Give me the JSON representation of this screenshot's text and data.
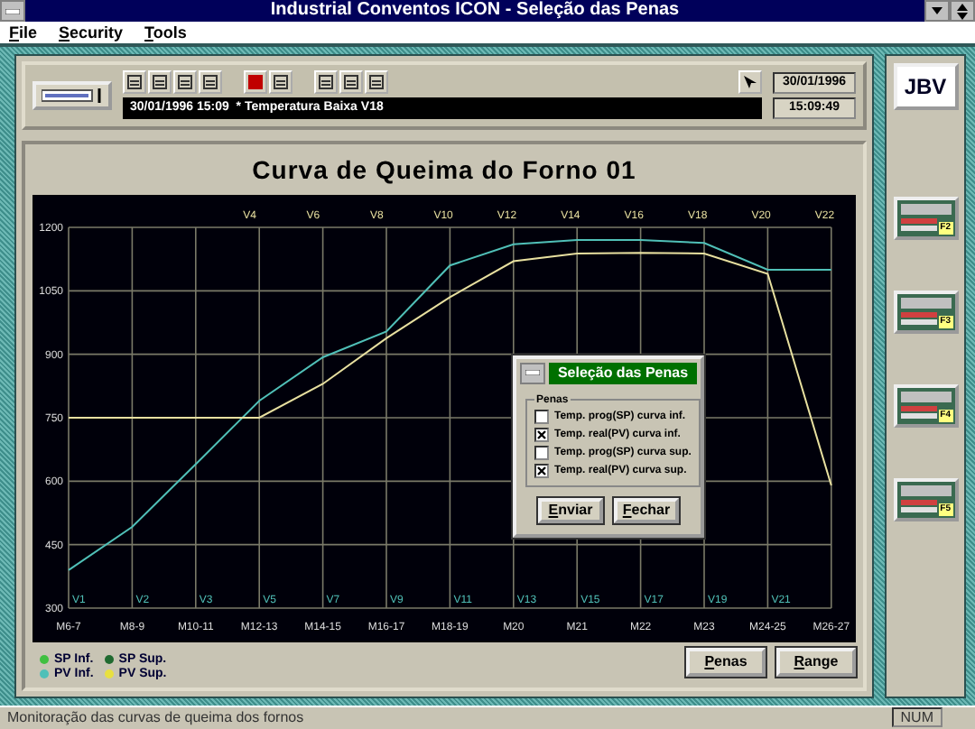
{
  "window": {
    "title": "Industrial Conventos ICON - Seleção das Penas"
  },
  "menu": [
    {
      "label": "File"
    },
    {
      "label": "Security"
    },
    {
      "label": "Tools"
    }
  ],
  "toolbar": {
    "message": "30/01/1996 15:09  * Temperatura Baixa V18",
    "date": "30/01/1996",
    "time": "15:09:49"
  },
  "logo": {
    "text": "JBV"
  },
  "chart_panel": {
    "title": "Curva de Queima do Forno 01",
    "category_markers": [
      {
        "bottom": "V1"
      },
      {
        "bottom": "V2"
      },
      {
        "bottom": "V3"
      },
      {
        "top": "V4",
        "bottom": "V5"
      },
      {
        "top": "V6",
        "bottom": "V7"
      },
      {
        "top": "V8",
        "bottom": "V9"
      },
      {
        "top": "V10",
        "bottom": "V11"
      },
      {
        "top": "V12",
        "bottom": "V13"
      },
      {
        "top": "V14",
        "bottom": "V15"
      },
      {
        "top": "V16",
        "bottom": "V17"
      },
      {
        "top": "V18",
        "bottom": "V19"
      },
      {
        "top": "V20",
        "bottom": "V21"
      },
      {
        "top": "V22"
      }
    ],
    "chart_data": {
      "type": "line",
      "grid": true,
      "categories": [
        "M6-7",
        "M8-9",
        "M10-11",
        "M12-13",
        "M14-15",
        "M16-17",
        "M18-19",
        "M20",
        "M21",
        "M22",
        "M23",
        "M24-25",
        "M26-27"
      ],
      "ylim": [
        300,
        1200
      ],
      "yticks": [
        300,
        450,
        600,
        750,
        900,
        1050,
        1200
      ],
      "series": [
        {
          "color": "#50c0b8",
          "values": [
            390,
            492,
            640,
            790,
            893,
            954,
            1110,
            1160,
            1170,
            1170,
            1163,
            1100,
            1100
          ]
        },
        {
          "color": "#e8e0a0",
          "values": [
            750,
            750,
            750,
            750,
            830,
            938,
            1035,
            1120,
            1138,
            1140,
            1138,
            1090,
            590
          ]
        }
      ]
    },
    "legend": [
      {
        "label": "SP Inf.",
        "color": "#40c040"
      },
      {
        "label": "SP Sup.",
        "color": "#206a30"
      },
      {
        "label": "PV Inf.",
        "color": "#50c0b8"
      },
      {
        "label": "PV Sup.",
        "color": "#e8e040"
      }
    ],
    "buttons": [
      "Penas",
      "Range"
    ]
  },
  "dialog": {
    "title": "Seleção das Penas",
    "group": "Penas",
    "options": [
      {
        "label": "Temp. prog(SP) curva inf.",
        "checked": false
      },
      {
        "label": "Temp. real(PV) curva inf.",
        "checked": true
      },
      {
        "label": "Temp. prog(SP) curva sup.",
        "checked": false
      },
      {
        "label": "Temp. real(PV) curva sup.",
        "checked": true
      }
    ],
    "buttons": [
      "Enviar",
      "Fechar"
    ]
  },
  "sidebar": [
    {
      "label": "F2"
    },
    {
      "label": "F3"
    },
    {
      "label": "F4"
    },
    {
      "label": "F5"
    }
  ],
  "status_bar": {
    "text": "Monitoração das curvas de queima dos fornos",
    "indicator": "NUM"
  }
}
